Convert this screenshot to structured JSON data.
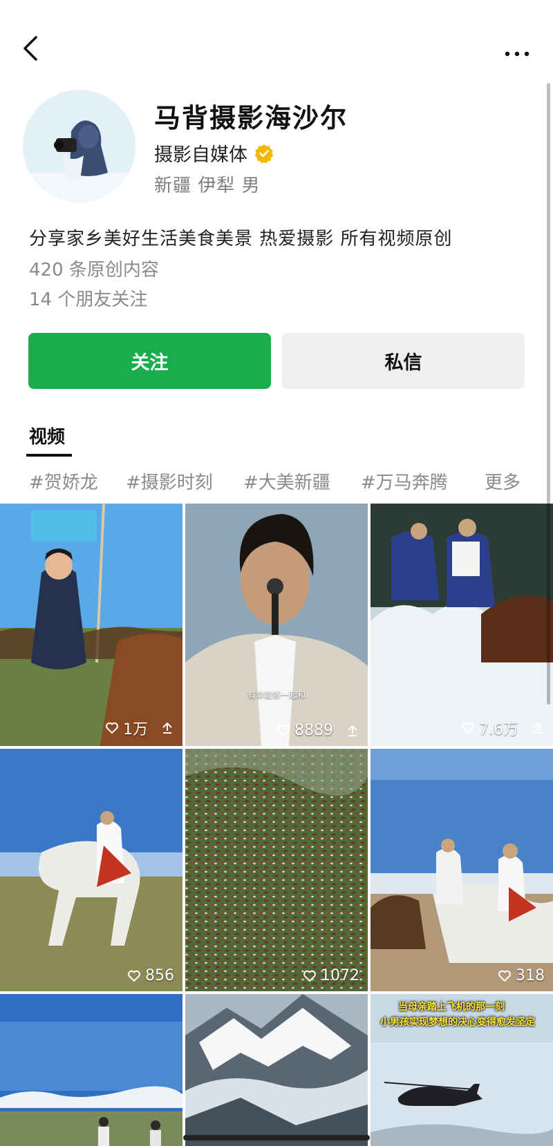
{
  "profile": {
    "name": "马背摄影海沙尔",
    "role": "摄影自媒体",
    "location": "新疆 伊犁 男",
    "bio": "分享家乡美好生活美食美景 热爱摄影 所有视频原创",
    "original_count": "420 条原创内容",
    "friends_following": "14 个朋友关注"
  },
  "actions": {
    "follow_label": "关注",
    "message_label": "私信"
  },
  "tabs": [
    {
      "label": "视频",
      "active": true
    }
  ],
  "tags": [
    "#贺娇龙",
    "#摄影时刻",
    "#大美新疆",
    "#万马奔腾",
    "更多"
  ],
  "videos": [
    {
      "likes": "1万",
      "shareable": true,
      "scene": "man-suit-horse-flag"
    },
    {
      "likes": "8889",
      "shareable": true,
      "scene": "man-microphone",
      "caption": "有幸能够一起和"
    },
    {
      "likes": "7.6万",
      "shareable": true,
      "scene": "riders-splashing-river"
    },
    {
      "likes": "856",
      "scene": "woman-white-horse-grassland"
    },
    {
      "likes": "1072",
      "scene": "aerial-horse-herd"
    },
    {
      "likes": "318",
      "scene": "women-on-horses"
    },
    {
      "likes": "",
      "scene": "riders-blue-sky"
    },
    {
      "likes": "",
      "scene": "snowy-mountains"
    },
    {
      "likes": "",
      "scene": "helicopter",
      "caption_lines": [
        "当母亲踏上飞机的那一刻",
        "小男孩实现梦想的决心变得愈发坚定"
      ]
    }
  ],
  "colors": {
    "accent_green": "#1aad4e",
    "secondary_button": "#efefef",
    "muted_text": "#8a8a8a",
    "verified_badge": "#f5b800"
  },
  "icons": {
    "back": "chevron-left-icon",
    "more": "more-dots-icon",
    "verified": "verified-badge-icon",
    "like": "heart-icon",
    "share": "share-icon"
  }
}
